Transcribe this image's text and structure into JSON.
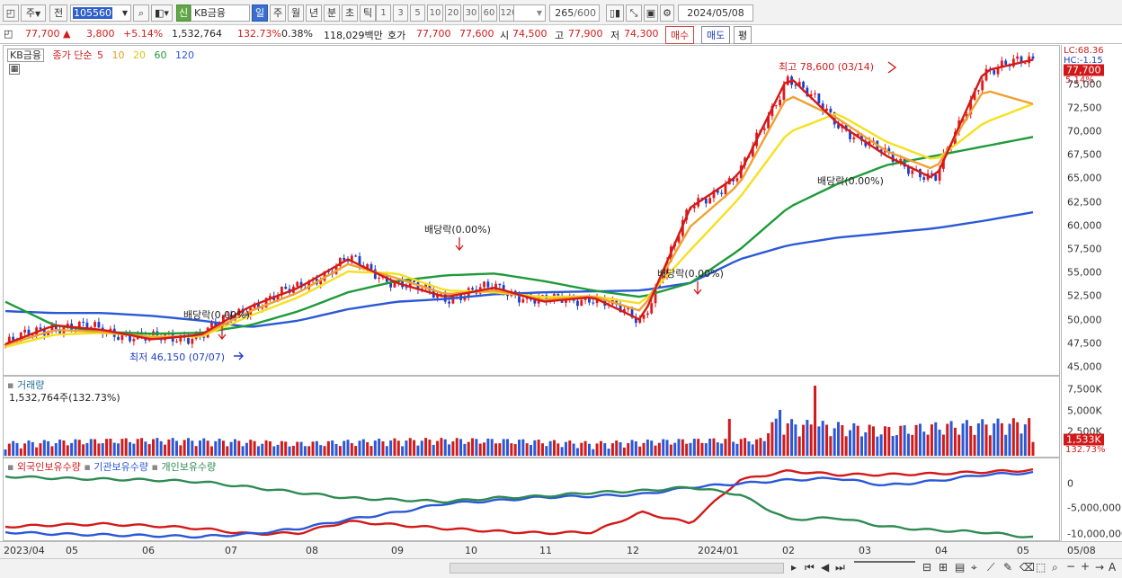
{
  "toolbar": {
    "period_main": "주",
    "prev": "전",
    "code": "105560",
    "credit_badge": "신",
    "stock_name": "KB금융",
    "periods": [
      "일",
      "주",
      "월",
      "년",
      "분",
      "초",
      "틱"
    ],
    "active_period": "일",
    "intervals": [
      "1",
      "3",
      "5",
      "10",
      "20",
      "30",
      "60",
      "120"
    ],
    "count": "265",
    "count_total": "/600",
    "date": "2024/05/08"
  },
  "quote": {
    "price": "77,700",
    "change": "3,800",
    "change_pct": "+5.14%",
    "volume": "1,532,764",
    "volume_ratio": "132.73%",
    "turnover": "0.38%",
    "amount": "118,029백만",
    "bid_label": "호가",
    "ask": "77,700",
    "bid": "77,600",
    "open_label": "시",
    "open": "74,500",
    "high_label": "고",
    "high": "77,900",
    "low_label": "저",
    "low": "74,300",
    "buy_button": "매수",
    "sell_button": "매도",
    "eval_button": "평"
  },
  "price_pane": {
    "name_tag": "KB금융",
    "legend_main": "종가 단순",
    "ma_periods": [
      "5",
      "10",
      "20",
      "60",
      "120"
    ],
    "ma_colors": [
      "#d31919",
      "#f0a030",
      "#f5e020",
      "#1f9a3a",
      "#2a58d6"
    ],
    "lc": "LC:68.36",
    "hc": "HC:-1.15",
    "price_tag": "77,700",
    "pct_tag": "5.14%",
    "y_ticks": [
      "75,000",
      "72,500",
      "70,000",
      "67,500",
      "65,000",
      "62,500",
      "60,000",
      "57,500",
      "55,000",
      "52,500",
      "50,000",
      "47,500",
      "45,000"
    ],
    "high_note": "최고 78,600 (03/14)",
    "low_note": "최저 46,150 (07/07)",
    "dividend_notes": [
      "배당락(0.00%)",
      "배당락(0.00%)",
      "배당락(0.00%)",
      "배당락(0.00%)"
    ]
  },
  "volume_pane": {
    "title": "거래량",
    "value": "1,532,764주(132.73%)",
    "y_ticks": [
      "7,500K",
      "5,000K",
      "2,500K"
    ],
    "tag": "1,533K",
    "tag_pct": "132.73%"
  },
  "holding_pane": {
    "legend": [
      "외국인보유수량",
      "기관보유수량",
      "개인보유수량"
    ],
    "colors": [
      "#d21a1a",
      "#2a58d6",
      "#2e8a52"
    ],
    "y_ticks": [
      "0",
      "-5,000,000",
      "-10,000,000"
    ]
  },
  "x_axis": [
    "2023/04",
    "05",
    "06",
    "07",
    "08",
    "09",
    "10",
    "11",
    "12",
    "2024/01",
    "02",
    "03",
    "04",
    "05",
    "05/08"
  ],
  "chart_data": {
    "type": "candlestick",
    "title": "",
    "ylim": [
      45000,
      78600
    ],
    "high": 78600,
    "low": 46150,
    "last_close": 77700,
    "moving_averages": [
      {
        "name": "5",
        "values": [
          47500,
          49500,
          49000,
          48000,
          48500,
          51500,
          53500,
          56500,
          54000,
          52500,
          53500,
          52000,
          52500,
          50000,
          62000,
          65500,
          76000,
          71000,
          67500,
          65000,
          76500,
          77700
        ]
      },
      {
        "name": "10",
        "values": [
          47400,
          49000,
          48800,
          48200,
          48400,
          51000,
          53000,
          56000,
          54500,
          52800,
          53200,
          52200,
          52600,
          51000,
          60000,
          64500,
          74000,
          71500,
          68000,
          66000,
          74500,
          73000
        ]
      },
      {
        "name": "20",
        "values": [
          47200,
          48500,
          48700,
          48300,
          48300,
          50500,
          52500,
          55200,
          55000,
          53200,
          53000,
          52500,
          52600,
          51800,
          57500,
          63000,
          70000,
          72000,
          69000,
          67000,
          71000,
          73000
        ]
      },
      {
        "name": "60",
        "values": [
          52000,
          49500,
          48800,
          48600,
          48700,
          49500,
          51000,
          53000,
          54200,
          54800,
          55000,
          54200,
          53200,
          52500,
          54000,
          57500,
          62000,
          64500,
          66500,
          67500,
          68500,
          69500
        ]
      },
      {
        "name": "120",
        "values": [
          51000,
          50800,
          50800,
          50500,
          50000,
          49300,
          50000,
          51200,
          52000,
          52300,
          52800,
          53000,
          53100,
          53200,
          54000,
          56500,
          58000,
          58800,
          59300,
          59800,
          60600,
          61500
        ]
      }
    ],
    "volume_ylim": [
      0,
      8000000
    ],
    "volume_last": 1532764
  }
}
